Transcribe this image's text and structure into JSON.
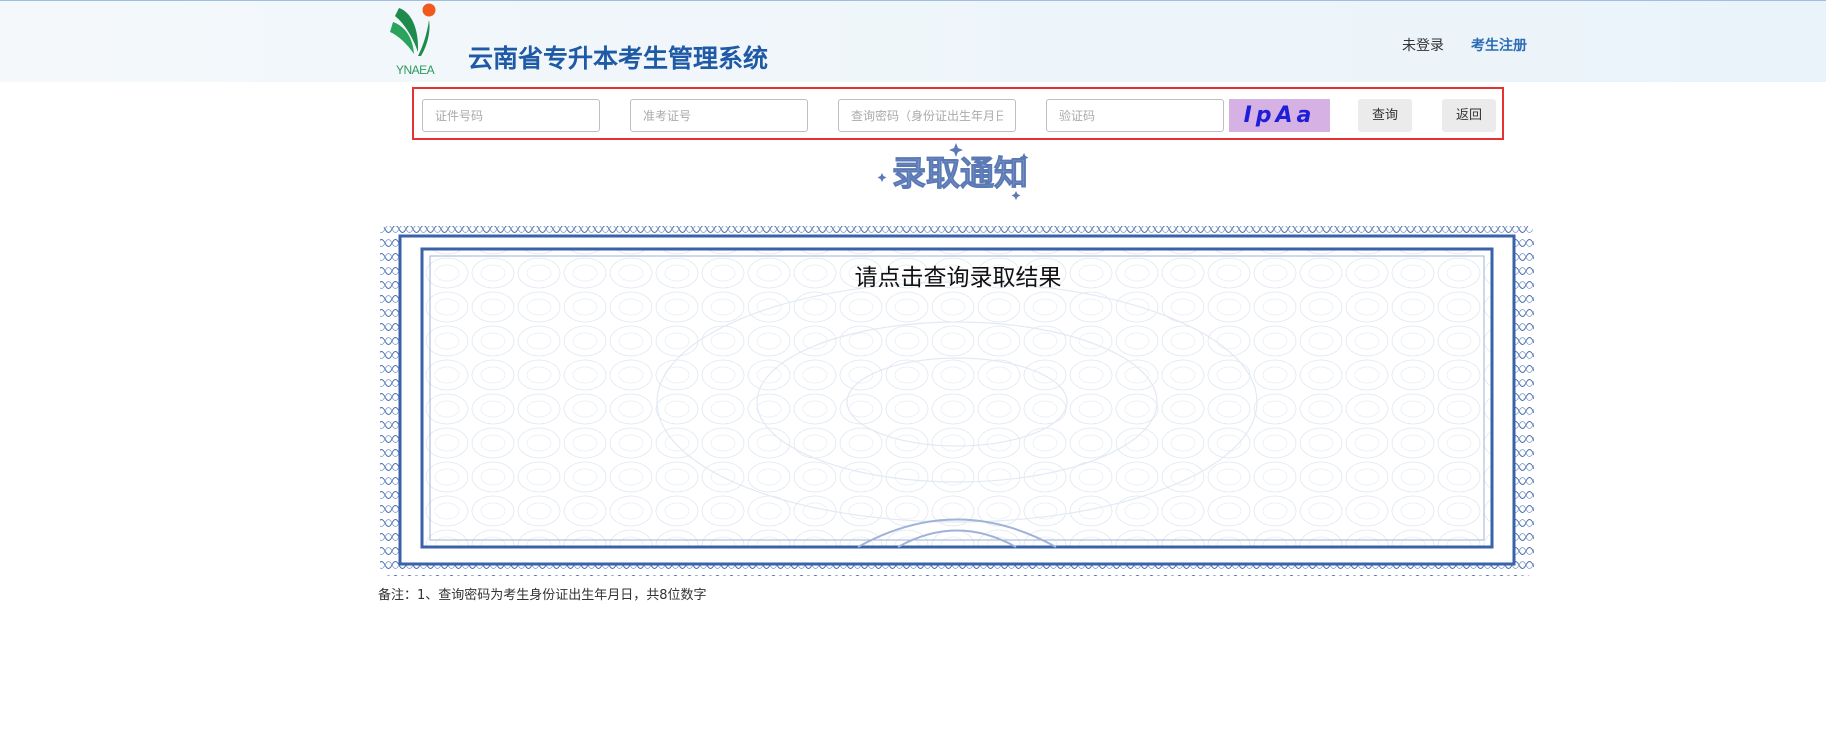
{
  "header": {
    "logo_text": "YNAEA",
    "title": "云南省专升本考生管理系统",
    "login_status": "未登录",
    "register_link": "考生注册"
  },
  "search": {
    "id_placeholder": "证件号码",
    "ticket_placeholder": "准考证号",
    "password_placeholder": "查询密码（身份证出生年月日）",
    "captcha_placeholder": "验证码",
    "captcha_text": "IpAa",
    "query_label": "查询",
    "back_label": "返回"
  },
  "notice": {
    "badge_text": "录取通知",
    "prompt": "请点击查询录取结果"
  },
  "footer": {
    "note": "备注：1、查询密码为考生身份证出生年月日，共8位数字"
  },
  "colors": {
    "title_blue": "#1f5aa6",
    "border_red": "#e53333",
    "captcha_bg": "#d5b1e4",
    "frame_blue": "#3a62a8"
  }
}
